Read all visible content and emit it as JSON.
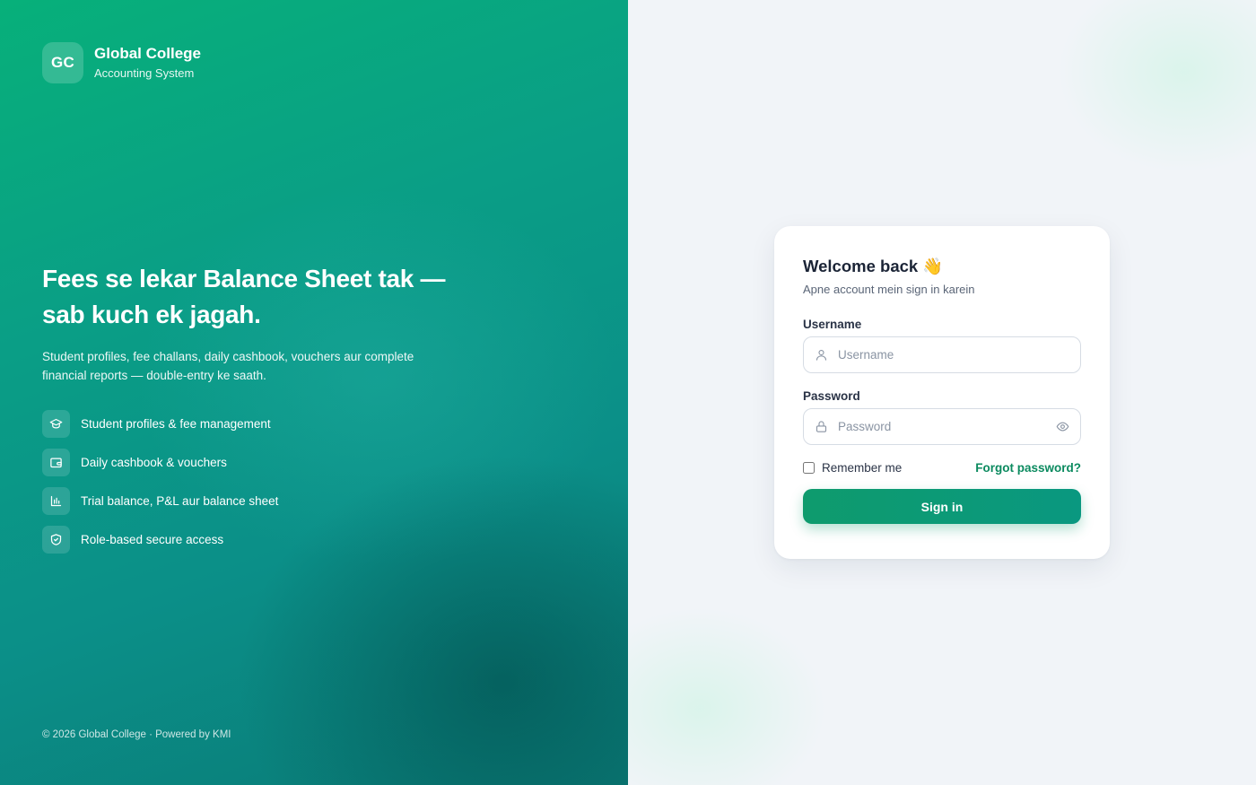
{
  "brand": {
    "logo_text": "GC",
    "name": "Global College",
    "subtitle": "Accounting System"
  },
  "hero": {
    "title": "Fees se lekar Balance Sheet tak — sab kuch ek jagah.",
    "description": "Student profiles, fee challans, daily cashbook, vouchers aur complete financial reports — double-entry ke saath."
  },
  "features": [
    {
      "icon": "graduation-cap-icon",
      "label": "Student profiles & fee management"
    },
    {
      "icon": "wallet-icon",
      "label": "Daily cashbook & vouchers"
    },
    {
      "icon": "bar-chart-icon",
      "label": "Trial balance, P&L aur balance sheet"
    },
    {
      "icon": "shield-check-icon",
      "label": "Role-based secure access"
    }
  ],
  "footer": "© 2026 Global College · Powered by KMI",
  "login": {
    "title": "Welcome back 👋",
    "subtitle": "Apne account mein sign in karein",
    "username_label": "Username",
    "username_placeholder": "Username",
    "username_icon": "user-icon",
    "password_label": "Password",
    "password_placeholder": "Password",
    "password_icon": "lock-icon",
    "show_password_icon": "eye-icon",
    "remember_label": "Remember me",
    "remember_checked": false,
    "forgot_label": "Forgot password?",
    "signin_label": "Sign in"
  },
  "colors": {
    "accent": "#0e9b6d",
    "link": "#0b8a5f",
    "panel_start": "#07b07a",
    "panel_end": "#0a7a76"
  }
}
